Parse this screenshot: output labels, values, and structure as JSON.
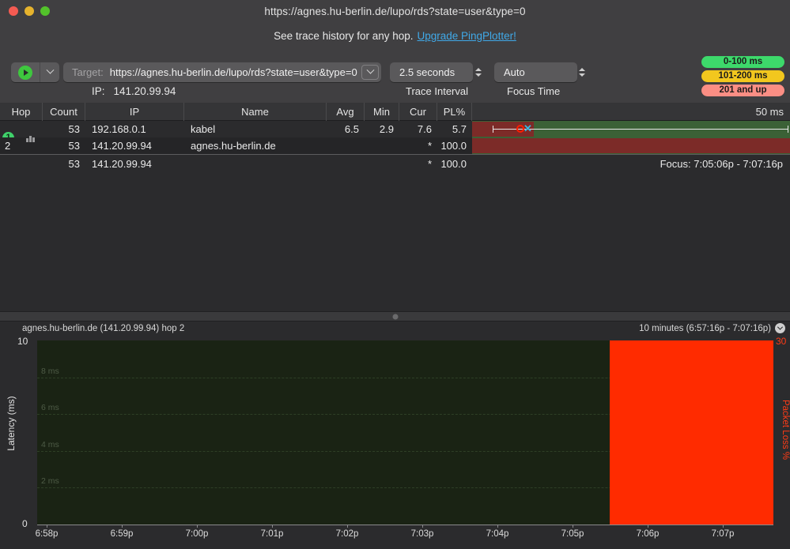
{
  "window": {
    "title": "https://agnes.hu-berlin.de/lupo/rds?state=user&type=0",
    "traffic_lights": [
      "close-button",
      "minimize-button",
      "zoom-button"
    ]
  },
  "promo": {
    "text": "See trace history for any hop.",
    "link": "Upgrade PingPlotter!"
  },
  "toolbar": {
    "target_label": "Target:",
    "target_value": "https://agnes.hu-berlin.de/lupo/rds?state=user&type=0",
    "ip_label": "IP:",
    "ip_value": "141.20.99.94",
    "trace_interval_value": "2.5 seconds",
    "trace_interval_caption": "Trace Interval",
    "focus_time_value": "Auto",
    "focus_time_caption": "Focus Time",
    "legend": [
      {
        "label": "0-100 ms",
        "color": "#3dd96b"
      },
      {
        "label": "101-200 ms",
        "color": "#f2c71e"
      },
      {
        "label": "201 and up",
        "color": "#fb8e84"
      }
    ]
  },
  "table": {
    "columns": [
      "Hop",
      "Count",
      "IP",
      "Name",
      "Avg",
      "Min",
      "Cur",
      "PL%"
    ],
    "graph_scale_label": "50 ms",
    "rows": [
      {
        "hop": "1",
        "hop_selected": true,
        "has_chart_icon": false,
        "count": "53",
        "ip": "192.168.0.1",
        "name": "kabel",
        "avg": "6.5",
        "min": "2.9",
        "cur": "7.6",
        "pl": "5.7"
      },
      {
        "hop": "2",
        "hop_selected": false,
        "has_chart_icon": true,
        "count": "53",
        "ip": "141.20.99.94",
        "name": "agnes.hu-berlin.de",
        "avg": "",
        "min": "",
        "cur": "*",
        "pl": "100.0"
      }
    ],
    "summary_row": {
      "count": "53",
      "ip": "141.20.99.94",
      "name": "",
      "avg": "",
      "min": "",
      "cur": "*",
      "pl": "100.0"
    },
    "focus_label": "Focus: 7:05:06p - 7:07:16p"
  },
  "graph": {
    "title": "agnes.hu-berlin.de (141.20.99.94) hop 2",
    "range_label": "10 minutes (6:57:16p - 7:07:16p)"
  },
  "chart_data": {
    "type": "area",
    "title": "agnes.hu-berlin.de (141.20.99.94) hop 2",
    "subtitle": "10 minutes (6:57:16p - 7:07:16p)",
    "xlabel": "",
    "ylabel": "Latency (ms)",
    "ylabel_right": "Packet Loss %",
    "ylim": [
      0,
      10
    ],
    "ylim_right": [
      0,
      30
    ],
    "ytick_labels": [
      "0",
      "10"
    ],
    "gridline_labels": [
      "2 ms",
      "4 ms",
      "6 ms",
      "8 ms"
    ],
    "gridline_values": [
      2,
      4,
      6,
      8
    ],
    "grid": true,
    "legend_position": "none",
    "x_tick_labels": [
      "6:58p",
      "6:59p",
      "7:00p",
      "7:01p",
      "7:02p",
      "7:03p",
      "7:04p",
      "7:05p",
      "7:06p",
      "7:07p"
    ],
    "series": [
      {
        "name": "Latency",
        "values": [],
        "note": "no latency samples plotted (100% packet loss at this hop)"
      },
      {
        "name": "Packet Loss %",
        "color": "#ff2b00",
        "x_start": "7:05p",
        "x_end": "7:07p",
        "value": 30,
        "note": "solid 100% loss block spanning 7:05p to end of window"
      }
    ],
    "background_color": "#1a2314"
  }
}
